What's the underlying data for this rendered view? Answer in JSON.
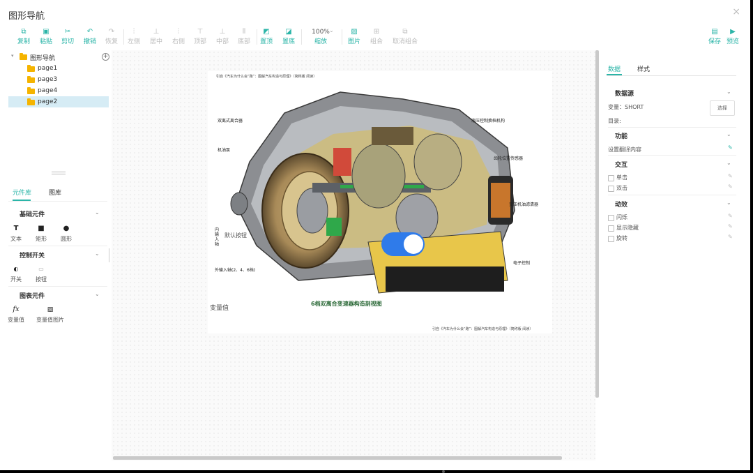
{
  "window": {
    "title": "图形导航"
  },
  "toolbar": {
    "copy": "复制",
    "paste": "粘贴",
    "cut": "剪切",
    "undo": "撤销",
    "redo": "恢复",
    "align_left": "左侧",
    "align_center": "居中",
    "align_right": "右侧",
    "align_top": "顶部",
    "align_middle": "中部",
    "align_bottom": "底部",
    "bring_front": "置顶",
    "send_back": "置底",
    "zoom_value": "100%",
    "zoom_label": "缩放",
    "image": "图片",
    "group": "组合",
    "ungroup": "取消组合",
    "save": "保存",
    "preview": "预览"
  },
  "tree": {
    "root": "图形导航",
    "pages": [
      "page1",
      "page3",
      "page4",
      "page2"
    ],
    "selected_index": 3
  },
  "library": {
    "tabs": [
      "元件库",
      "图库"
    ],
    "sections": [
      {
        "title": "基础元件",
        "items": [
          "文本",
          "矩形",
          "圆形"
        ]
      },
      {
        "title": "控制开关",
        "items": [
          "开关",
          "按钮"
        ]
      },
      {
        "title": "图表元件",
        "items": [
          "变量值",
          "变量值图片"
        ]
      }
    ]
  },
  "canvas": {
    "caption_top": "引自《汽车为什么会“跑”：图解汽车构造与原理》（简称版 阅读）",
    "caption_bottom": "引自《汽车为什么会“跑”：图解汽车构造与原理》（简称版 阅读）",
    "image_title": "6档双离合变速器构造剖视图",
    "labels": {
      "dual_clutch": "双离式离合器",
      "oil_pump": "机油泵",
      "hydraulic": "液压控制换档机构",
      "gear_sensor": "齿轮位置传感器",
      "oil_filter": "变压机油滤清器",
      "inner_shaft": "内输入轴",
      "outer_shaft": "外输入轴(2、4、6档)",
      "electronic": "电子控制"
    },
    "default_button": "默认按钮",
    "variable_value": "变量值",
    "toggle_on": true
  },
  "right_panel": {
    "tabs": [
      "数据",
      "样式"
    ],
    "datasource_title": "数据源",
    "variable_label": "变量：SHORT",
    "select_button": "选择",
    "directory_label": "目录:",
    "function_title": "功能",
    "function_item": "设置翻译内容",
    "interaction_title": "交互",
    "interaction_items": [
      "单击",
      "双击"
    ],
    "animation_title": "动效",
    "animation_items": [
      "闪烁",
      "显示隐藏",
      "旋转"
    ]
  },
  "colors": {
    "accent": "#2bb5a8",
    "toggle": "#2f7bea",
    "folder": "#f5b400",
    "selected_row": "#d6ecf5"
  }
}
